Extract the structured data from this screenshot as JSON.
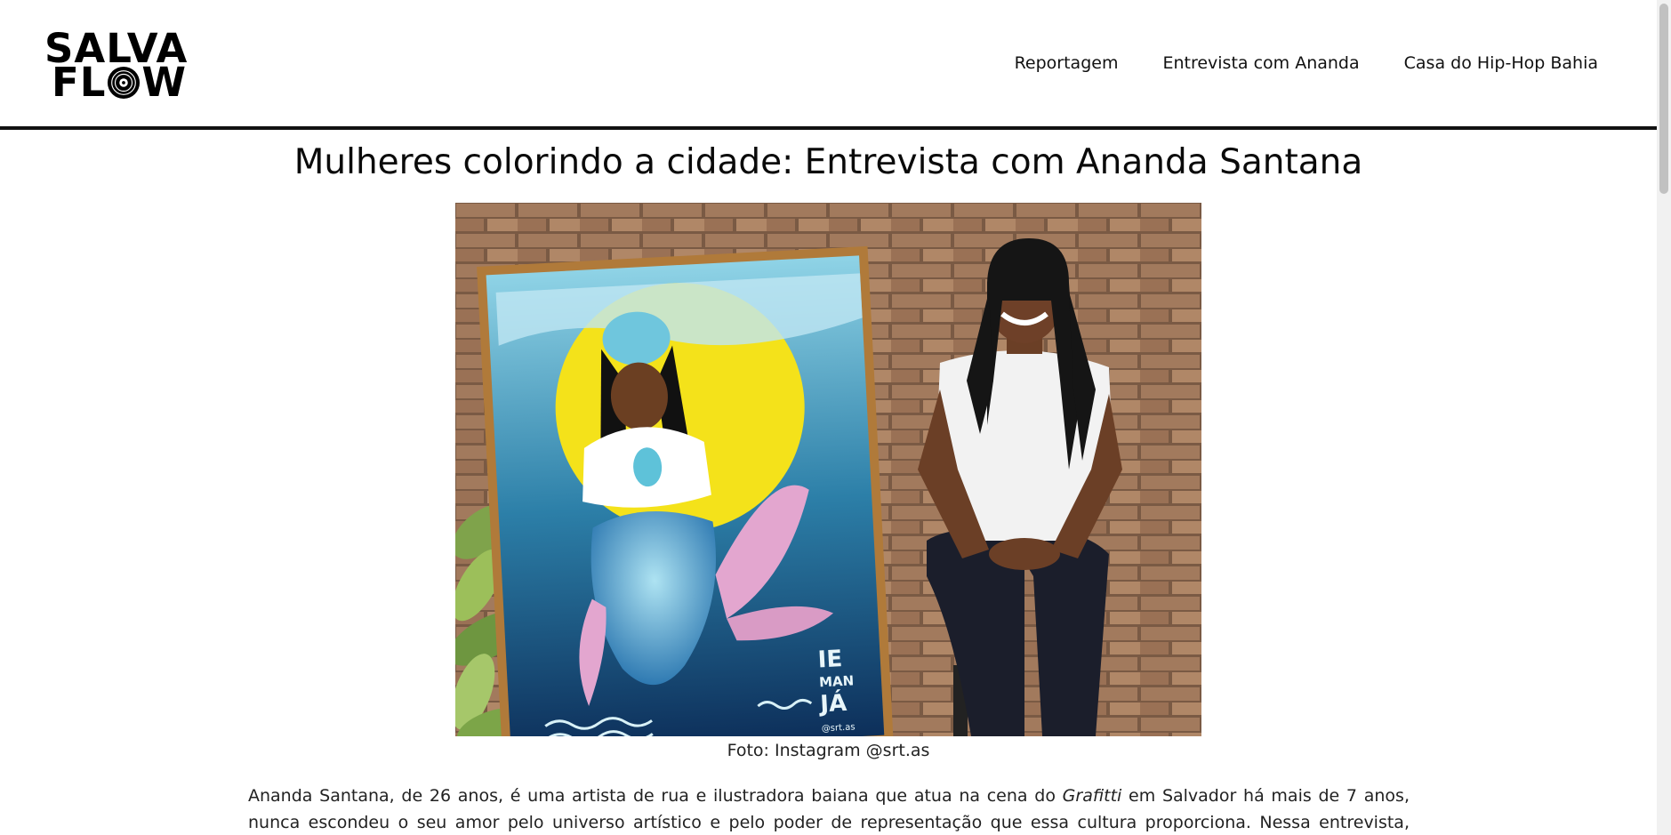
{
  "brand": {
    "logo_line1": "SALVA",
    "logo_line2_pre": "FL",
    "logo_line2_post": "W"
  },
  "nav": {
    "items": [
      {
        "label": "Reportagem"
      },
      {
        "label": "Entrevista com Ananda"
      },
      {
        "label": "Casa do Hip-Hop Bahia"
      }
    ]
  },
  "article": {
    "title": "Mulheres colorindo a cidade: Entrevista com Ananda Santana",
    "image_caption": "Foto: Instagram @srt.as",
    "painting_text": {
      "line1": "IE",
      "line2": "MAN",
      "line3": "JÁ",
      "signature": "@srt.as"
    },
    "intro_part1": "Ananda Santana, de 26 anos, é uma artista de rua e ilustradora baiana que atua na cena do ",
    "intro_emph": "Grafitti",
    "intro_part2": " em Salvador há mais de 7 anos, nunca escondeu o seu amor pelo universo artístico e pelo poder de representação que essa cultura proporciona. Nessa entrevista, Ananda comenta um pouco da"
  },
  "colors": {
    "brand": "#000000",
    "border": "#111111",
    "text": "#222222"
  }
}
